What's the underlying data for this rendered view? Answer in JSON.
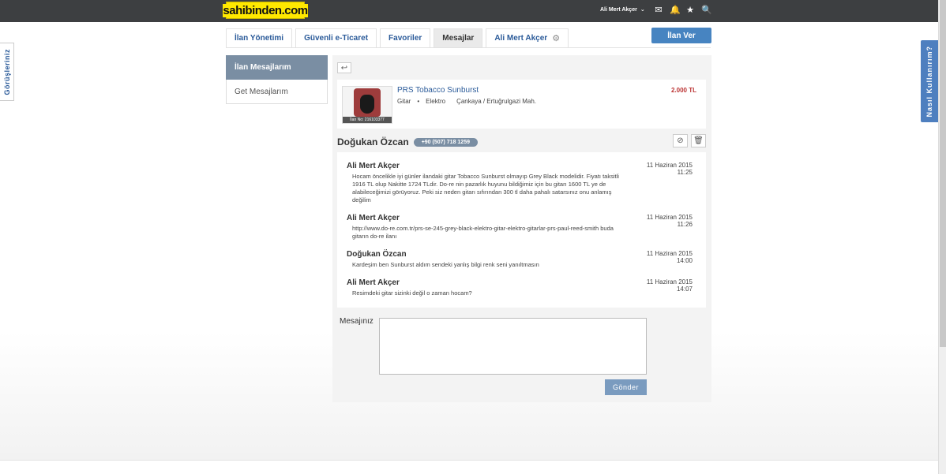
{
  "header": {
    "logo": "sahibinden.com",
    "user_menu": "Ali Mert Akçer",
    "icons": [
      "mail-icon",
      "bell-icon",
      "star-icon",
      "search-icon"
    ]
  },
  "side_tabs": {
    "feedback": "Görüşleriniz",
    "help": "Nasıl Kullanırım?"
  },
  "tabs": [
    {
      "label": "İlan Yönetimi"
    },
    {
      "label": "Güvenli e-Ticaret"
    },
    {
      "label": "Favoriler"
    },
    {
      "label": "Mesajlar"
    },
    {
      "label": "Ali Mert Akçer"
    }
  ],
  "ilan_ver": "İlan Ver",
  "left_menu": [
    {
      "label": "İlan Mesajlarım"
    },
    {
      "label": "Get Mesajlarım"
    }
  ],
  "listing": {
    "title": "PRS Tobacco Sunburst",
    "category": "Gitar",
    "subcategory": "Elektro",
    "location": "Çankaya / Ertuğrulgazi Mah.",
    "price": "2.000 TL",
    "ilan_no": "İlan No: 216103377"
  },
  "conversation": {
    "name": "Doğukan Özcan",
    "phone": "+90 (507) 718 1259"
  },
  "messages": [
    {
      "sender": "Ali Mert Akçer",
      "text": "Hocam öncelikle iyi günler ilandaki gitar Tobacco Sunburst olmayıp Grey Black modelidir. Fiyatı taksitli 1916 TL olup Nakitte 1724 TLdir. Do-re nin pazarlık huyunu bildiğimiz için bu gitarı 1600 TL ye de alabileceğimizi görüyoruz. Peki siz neden gitarı sıfırından 300 tl daha pahalı satarsınız onu anlamış değilim",
      "date": "11 Haziran 2015",
      "time": "11:25"
    },
    {
      "sender": "Ali Mert Akçer",
      "text": "http://www.do-re.com.tr/prs-se-245-grey-black-elektro-gitar-elektro-gitarlar-prs-paul-reed-smith buda gitarın do-re ilanı",
      "date": "11 Haziran 2015",
      "time": "11:26"
    },
    {
      "sender": "Doğukan Özcan",
      "text": "Kardeşim ben Sunburst aldım sendeki yanlış bilgi renk seni yanıltmasın",
      "date": "11 Haziran 2015",
      "time": "14:00"
    },
    {
      "sender": "Ali Mert Akçer",
      "text": "Resimdeki gitar sizinki değil o zaman hocam?",
      "date": "11 Haziran 2015",
      "time": "14:07"
    }
  ],
  "reply": {
    "label": "Mesajınız",
    "placeholder": "",
    "send_label": "Gönder"
  }
}
